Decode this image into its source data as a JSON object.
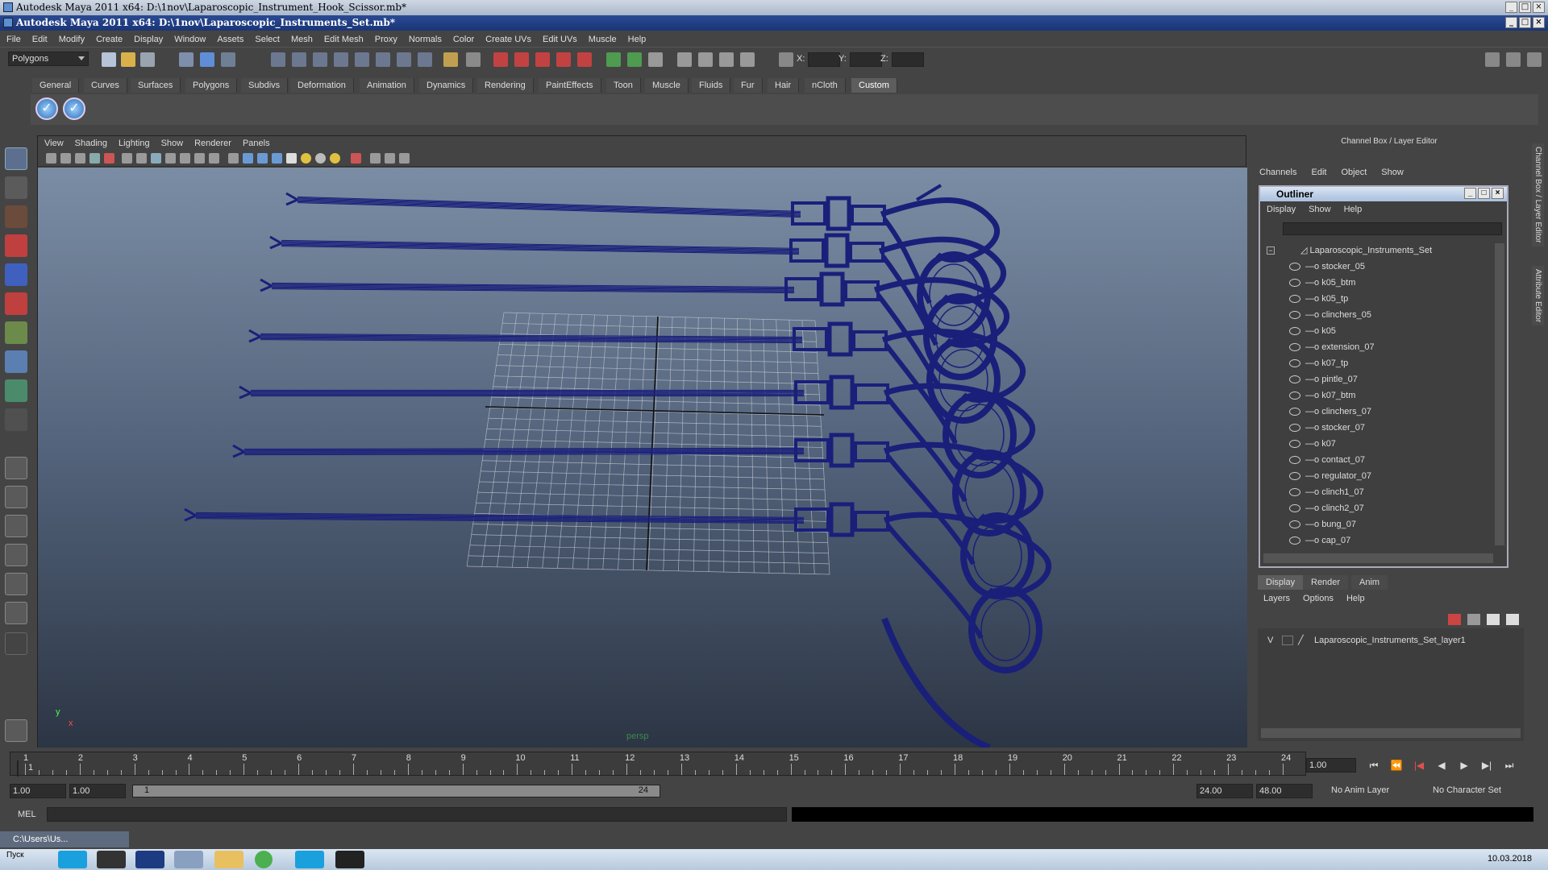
{
  "title_bar": {
    "outer_title": "Autodesk Maya 2011 x64: D:\\1nov\\Laparoscopic_Instrument_Hook_Scissor.mb*",
    "inner_title": "Autodesk Maya 2011 x64: D:\\1nov\\Laparoscopic_Instruments_Set.mb*"
  },
  "menubar": [
    "File",
    "Edit",
    "Modify",
    "Create",
    "Display",
    "Window",
    "Assets",
    "Select",
    "Mesh",
    "Edit Mesh",
    "Proxy",
    "Normals",
    "Color",
    "Create UVs",
    "Edit UVs",
    "Muscle",
    "Help"
  ],
  "status_line": {
    "mode": "Polygons",
    "x_label": "X:",
    "y_label": "Y:",
    "z_label": "Z:"
  },
  "shelf": {
    "tabs": [
      "General",
      "Curves",
      "Surfaces",
      "Polygons",
      "Subdivs",
      "Deformation",
      "Animation",
      "Dynamics",
      "Rendering",
      "PaintEffects",
      "Toon",
      "Muscle",
      "Fluids",
      "Fur",
      "Hair",
      "nCloth",
      "Custom"
    ],
    "active_tab": "Custom"
  },
  "viewport": {
    "menu": [
      "View",
      "Shading",
      "Lighting",
      "Show",
      "Renderer",
      "Panels"
    ],
    "camera_label": "persp",
    "axis_y": "y",
    "axis_x": "x",
    "wire_color": "#1a1f7a"
  },
  "channel_box": {
    "title": "Channel Box / Layer Editor",
    "menu": [
      "Channels",
      "Edit",
      "Object",
      "Show"
    ]
  },
  "outliner": {
    "title": "Outliner",
    "menu": [
      "Display",
      "Show",
      "Help"
    ],
    "root": "Laparoscopic_Instruments_Set",
    "items": [
      "stocker_05",
      "k05_btm",
      "k05_tp",
      "clinchers_05",
      "k05",
      "extension_07",
      "k07_tp",
      "pintle_07",
      "k07_btm",
      "clinchers_07",
      "stocker_07",
      "k07",
      "contact_07",
      "regulator_07",
      "clinch1_07",
      "clinch2_07",
      "bung_07",
      "cap_07"
    ]
  },
  "layer_editor": {
    "tabs": [
      "Display",
      "Render",
      "Anim"
    ],
    "menu": [
      "Layers",
      "Options",
      "Help"
    ],
    "layer_visibility": "V",
    "layer_name": "Laparoscopic_Instruments_Set_layer1"
  },
  "side_tabs": [
    "Channel Box / Layer Editor",
    "Attribute Editor"
  ],
  "timeline": {
    "ticks": [
      "1",
      "2",
      "3",
      "4",
      "5",
      "6",
      "7",
      "8",
      "9",
      "10",
      "11",
      "12",
      "13",
      "14",
      "15",
      "16",
      "17",
      "18",
      "19",
      "20",
      "21",
      "22",
      "23",
      "24"
    ],
    "current_frame": "1.00",
    "start_marker": "1"
  },
  "range": {
    "start": "1.00",
    "anim_start": "1.00",
    "range_start": "1",
    "range_end": "24",
    "anim_end": "24.00",
    "end": "48.00",
    "anim_layer": "No Anim Layer",
    "char_set": "No Character Set"
  },
  "command_line": {
    "label": "MEL"
  },
  "taskbar": {
    "minimized_window": "C:\\Users\\Us...",
    "language": "Пуск",
    "date": "10.03.2018"
  }
}
